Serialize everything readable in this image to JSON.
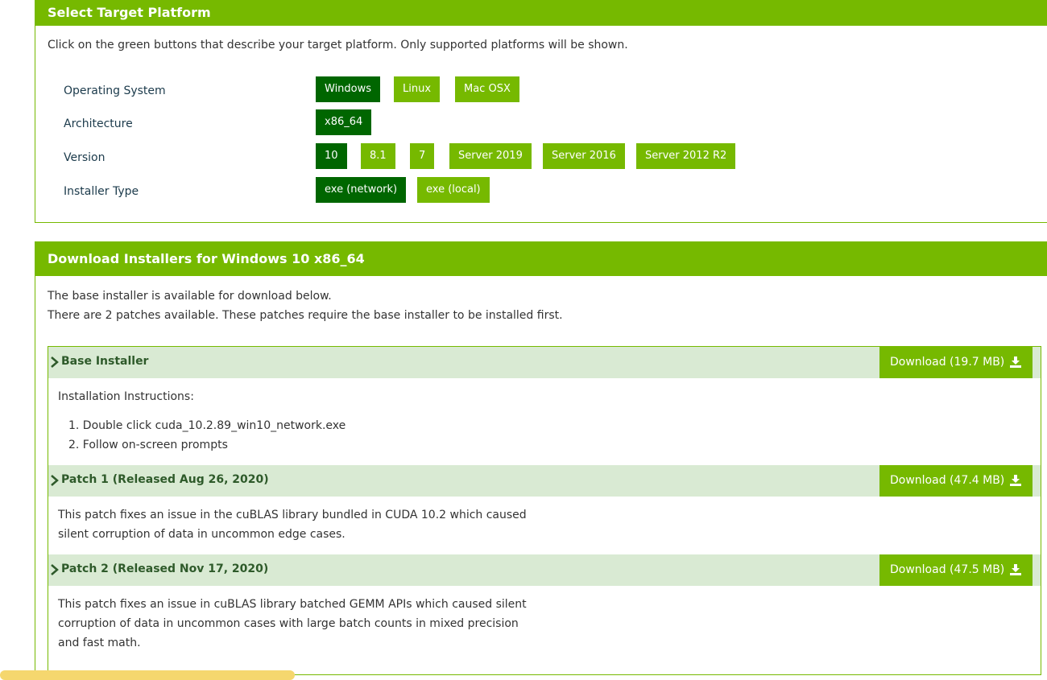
{
  "platform": {
    "title": "Select Target Platform",
    "description": "Click on the green buttons that describe your target platform. Only supported platforms will be shown.",
    "rows": [
      {
        "label": "Operating System",
        "options": [
          "Windows",
          "Linux",
          "Mac OSX"
        ],
        "selected": "Windows"
      },
      {
        "label": "Architecture",
        "options": [
          "x86_64"
        ],
        "selected": "x86_64"
      },
      {
        "label": "Version",
        "options": [
          "10",
          "8.1",
          "7",
          "Server 2019",
          "Server 2016",
          "Server 2012 R2"
        ],
        "selected": "10"
      },
      {
        "label": "Installer Type",
        "options": [
          "exe (network)",
          "exe (local)"
        ],
        "selected": "exe (network)"
      }
    ]
  },
  "downloads": {
    "title": "Download Installers for Windows 10 x86_64",
    "intro_line1": "The base installer is available for download below.",
    "intro_line2": "There are 2 patches available. These patches require the base installer to be installed first.",
    "base": {
      "title": "Base Installer",
      "download_label": "Download (19.7 MB)",
      "instructions_heading": "Installation Instructions:",
      "steps": [
        "1. Double click cuda_10.2.89_win10_network.exe",
        "2. Follow on-screen prompts"
      ]
    },
    "patch1": {
      "title": "Patch 1 (Released Aug 26, 2020)",
      "download_label": "Download (47.4 MB)",
      "text_line1": "This patch fixes an issue in the cuBLAS library bundled in CUDA 10.2 which caused",
      "text_line2": "silent corruption of data in uncommon edge cases."
    },
    "patch2": {
      "title": "Patch 2 (Released Nov 17, 2020)",
      "download_label": "Download (47.5 MB)",
      "text_line1": "This patch fixes an issue in cuBLAS library batched GEMM APIs which caused silent",
      "text_line2": "corruption of data in uncommon cases with large batch counts in mixed precision",
      "text_line3": "and fast math."
    }
  },
  "colors": {
    "accent": "#76b900",
    "selected": "#006600",
    "row_bg": "#d9ead3"
  }
}
